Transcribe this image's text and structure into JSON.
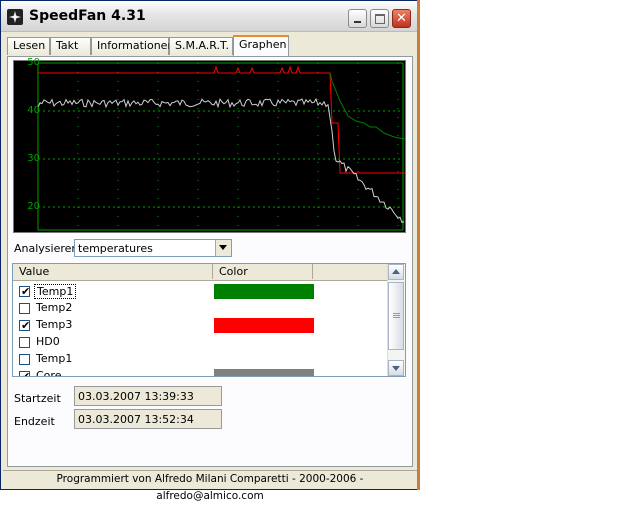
{
  "window": {
    "title": "SpeedFan 4.31"
  },
  "tabs": [
    {
      "label": "Lesen"
    },
    {
      "label": "Takt"
    },
    {
      "label": "Informationen"
    },
    {
      "label": "S.M.A.R.T."
    },
    {
      "label": "Graphen"
    }
  ],
  "graph": {
    "y_ticks": [
      "50",
      "40",
      "30",
      "20"
    ],
    "gridline_color": "#00a000",
    "background": "#000000"
  },
  "analysis": {
    "label": "Analysieren",
    "selected": "temperatures"
  },
  "list": {
    "headers": {
      "value": "Value",
      "color": "Color"
    },
    "rows": [
      {
        "label": "Temp1",
        "checked": true,
        "color": "#008000"
      },
      {
        "label": "Temp2",
        "checked": false,
        "color": ""
      },
      {
        "label": "Temp3",
        "checked": true,
        "color": "#ff0000"
      },
      {
        "label": "HD0",
        "checked": false,
        "color": ""
      },
      {
        "label": "Temp1",
        "checked": false,
        "color": ""
      },
      {
        "label": "Core",
        "checked": true,
        "color": "#808080"
      }
    ]
  },
  "times": {
    "start_label": "Startzeit",
    "start_value": "03.03.2007 13:39:33",
    "end_label": "Endzeit",
    "end_value": "03.03.2007 13:52:34"
  },
  "status": {
    "text": "Programmiert von Alfredo Milani Comparetti - 2000-2006 - alfredo@almico.com"
  }
}
